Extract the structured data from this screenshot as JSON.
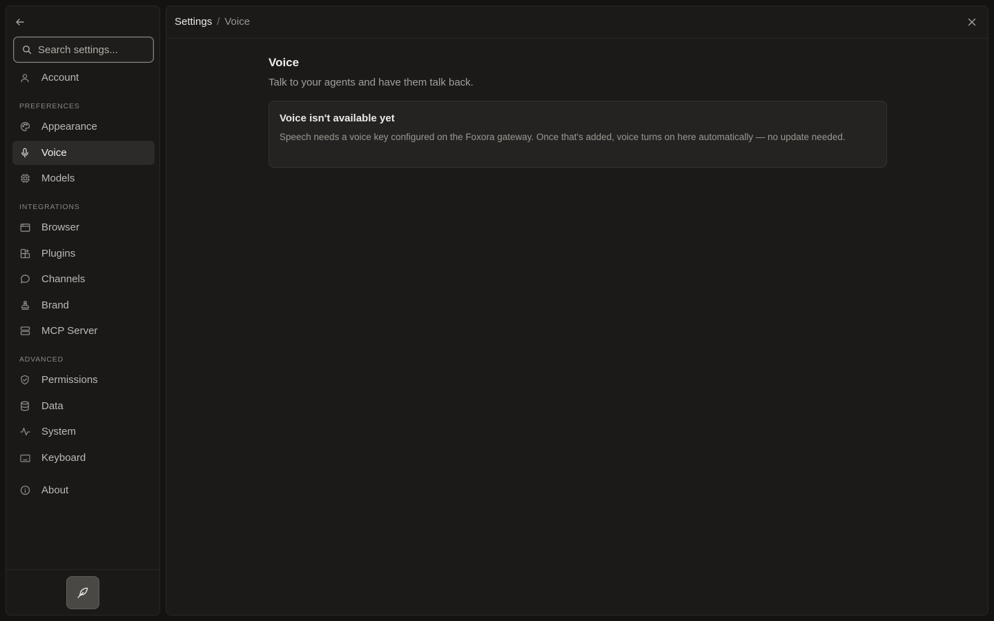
{
  "sidebar": {
    "search_placeholder": "Search settings...",
    "account_label": "Account",
    "sections": {
      "preferences": "PREFERENCES",
      "integrations": "INTEGRATIONS",
      "advanced": "ADVANCED"
    },
    "items": {
      "appearance": "Appearance",
      "voice": "Voice",
      "models": "Models",
      "browser": "Browser",
      "plugins": "Plugins",
      "channels": "Channels",
      "brand": "Brand",
      "mcp_server": "MCP Server",
      "permissions": "Permissions",
      "data": "Data",
      "system": "System",
      "keyboard": "Keyboard",
      "about": "About"
    },
    "active_item": "Voice"
  },
  "header": {
    "breadcrumb_root": "Settings",
    "breadcrumb_separator": "/",
    "breadcrumb_current": "Voice"
  },
  "main": {
    "title": "Voice",
    "subtitle": "Talk to your agents and have them talk back.",
    "notice": {
      "title": "Voice isn't available yet",
      "body": "Speech needs a voice key configured on the Foxora gateway. Once that's added, voice turns on here automatically — no update needed."
    }
  },
  "colors": {
    "background": "#141312",
    "panel": "#1b1a19",
    "active_item": "#2d2b29",
    "notice_bg": "#242321"
  }
}
